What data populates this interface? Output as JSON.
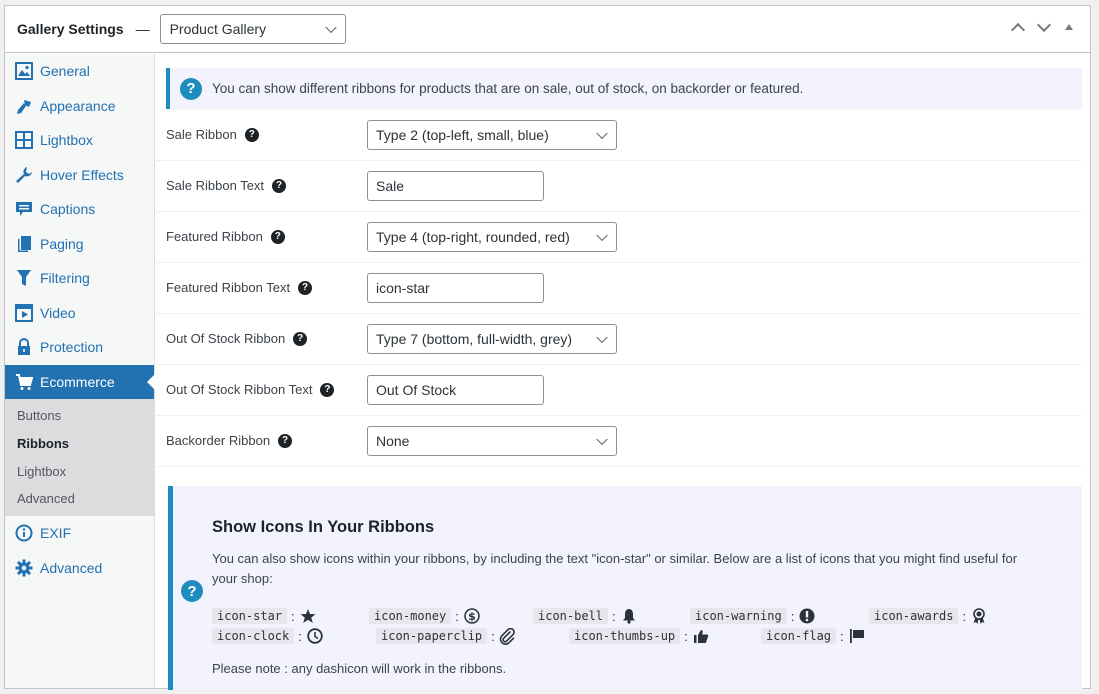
{
  "header": {
    "title": "Gallery Settings",
    "separator": "—",
    "gallery_select": "Product Gallery"
  },
  "sidebar": {
    "items": [
      {
        "label": "General",
        "icon": "image-icon"
      },
      {
        "label": "Appearance",
        "icon": "brush-icon"
      },
      {
        "label": "Lightbox",
        "icon": "grid-icon"
      },
      {
        "label": "Hover Effects",
        "icon": "wrench-icon"
      },
      {
        "label": "Captions",
        "icon": "caption-icon"
      },
      {
        "label": "Paging",
        "icon": "pages-icon"
      },
      {
        "label": "Filtering",
        "icon": "filter-icon"
      },
      {
        "label": "Video",
        "icon": "video-icon"
      },
      {
        "label": "Protection",
        "icon": "lock-icon"
      },
      {
        "label": "Ecommerce",
        "icon": "cart-icon",
        "active": true
      },
      {
        "label": "EXIF",
        "icon": "info-icon"
      },
      {
        "label": "Advanced",
        "icon": "gear-icon"
      }
    ],
    "submenu": [
      "Buttons",
      "Ribbons",
      "Lightbox",
      "Advanced"
    ],
    "submenu_current": "Ribbons"
  },
  "notice": {
    "text": "You can show different ribbons for products that are on sale, out of stock, on backorder or featured."
  },
  "fields": [
    {
      "label": "Sale Ribbon",
      "type": "select",
      "value": "Type 2 (top-left, small, blue)"
    },
    {
      "label": "Sale Ribbon Text",
      "type": "text",
      "value": "Sale"
    },
    {
      "label": "Featured Ribbon",
      "type": "select",
      "value": "Type 4 (top-right, rounded, red)"
    },
    {
      "label": "Featured Ribbon Text",
      "type": "text",
      "value": "icon-star"
    },
    {
      "label": "Out Of Stock Ribbon",
      "type": "select",
      "value": "Type 7 (bottom, full-width, grey)"
    },
    {
      "label": "Out Of Stock Ribbon Text",
      "type": "text",
      "value": "Out Of Stock"
    },
    {
      "label": "Backorder Ribbon",
      "type": "select",
      "value": "None"
    }
  ],
  "infobox": {
    "title": "Show Icons In Your Ribbons",
    "description": "You can also show icons within your ribbons, by including the text \"icon-star\" or similar. Below are a list of icons that you might find useful for your shop:",
    "icons_row1": [
      {
        "code": "icon-star",
        "icon": "star-icon"
      },
      {
        "code": "icon-money",
        "icon": "money-icon"
      },
      {
        "code": "icon-bell",
        "icon": "bell-icon"
      },
      {
        "code": "icon-warning",
        "icon": "warning-icon"
      },
      {
        "code": "icon-awards",
        "icon": "awards-icon"
      }
    ],
    "icons_row2": [
      {
        "code": "icon-clock",
        "icon": "clock-icon"
      },
      {
        "code": "icon-paperclip",
        "icon": "paperclip-icon"
      },
      {
        "code": "icon-thumbs-up",
        "icon": "thumbs-up-icon"
      },
      {
        "code": "icon-flag",
        "icon": "flag-icon"
      }
    ],
    "colon": ":",
    "note": "Please note : any dashicon will work in the ribbons."
  },
  "colors": {
    "accent": "#2271b1",
    "notice_border": "#1e8cbe",
    "notice_bg": "#f3f3fd"
  }
}
